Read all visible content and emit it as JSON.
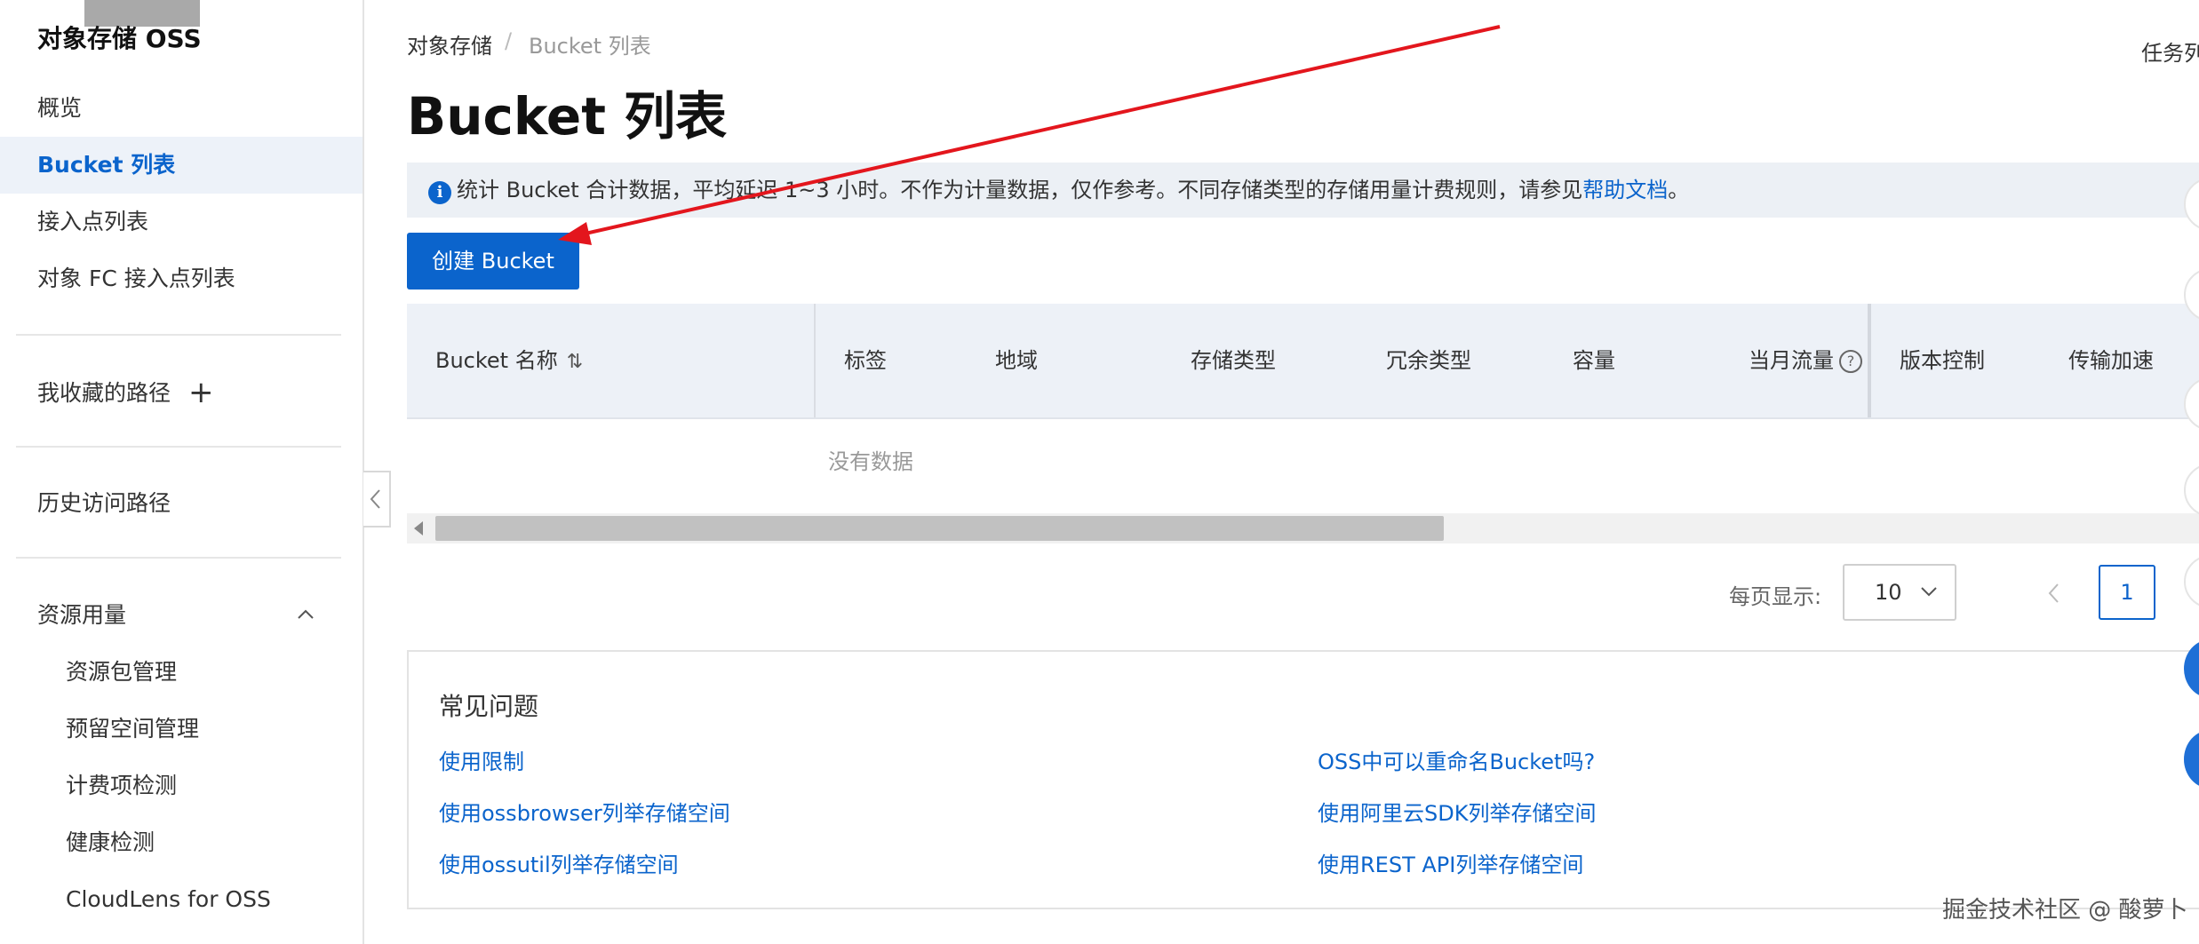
{
  "sidebar": {
    "title": "对象存储 OSS",
    "items": [
      {
        "label": "概览"
      },
      {
        "label": "Bucket 列表"
      },
      {
        "label": "接入点列表"
      },
      {
        "label": "对象 FC 接入点列表"
      }
    ],
    "favorites_label": "我收藏的路径",
    "history_label": "历史访问路径",
    "resource_section": "资源用量",
    "resource_items": [
      {
        "label": "资源包管理"
      },
      {
        "label": "预留空间管理"
      },
      {
        "label": "计费项检测"
      },
      {
        "label": "健康检测"
      },
      {
        "label": "CloudLens for OSS"
      }
    ]
  },
  "breadcrumb": {
    "root": "对象存储",
    "separator": "/",
    "current": "Bucket 列表"
  },
  "header": {
    "title": "Bucket 列表",
    "task_list": "任务列"
  },
  "notice": {
    "text": "统计 Bucket 合计数据，平均延迟 1~3 小时。不作为计量数据，仅作参考。不同存储类型的存储用量计费规则，请参见",
    "link": "帮助文档",
    "end": "。"
  },
  "toolbar": {
    "create_label": "创建 Bucket"
  },
  "table": {
    "columns": [
      "Bucket 名称",
      "标签",
      "地域",
      "存储类型",
      "冗余类型",
      "容量",
      "当月流量",
      "版本控制",
      "传输加速"
    ],
    "empty_text": "没有数据"
  },
  "pagination": {
    "per_page_label": "每页显示:",
    "per_page_value": "10",
    "current_page": "1"
  },
  "faq": {
    "title": "常见问题",
    "left_links": [
      "使用限制",
      "使用ossbrowser列举存储空间",
      "使用ossutil列举存储空间"
    ],
    "right_links": [
      "OSS中可以重命名Bucket吗?",
      "使用阿里云SDK列举存储空间",
      "使用REST API列举存储空间"
    ]
  },
  "watermark": "掘金技术社区 @ 酸萝卜",
  "colors": {
    "accent": "#0b64cc",
    "annotation_arrow": "#e3161d",
    "notice_bg": "#ecf0f5"
  }
}
